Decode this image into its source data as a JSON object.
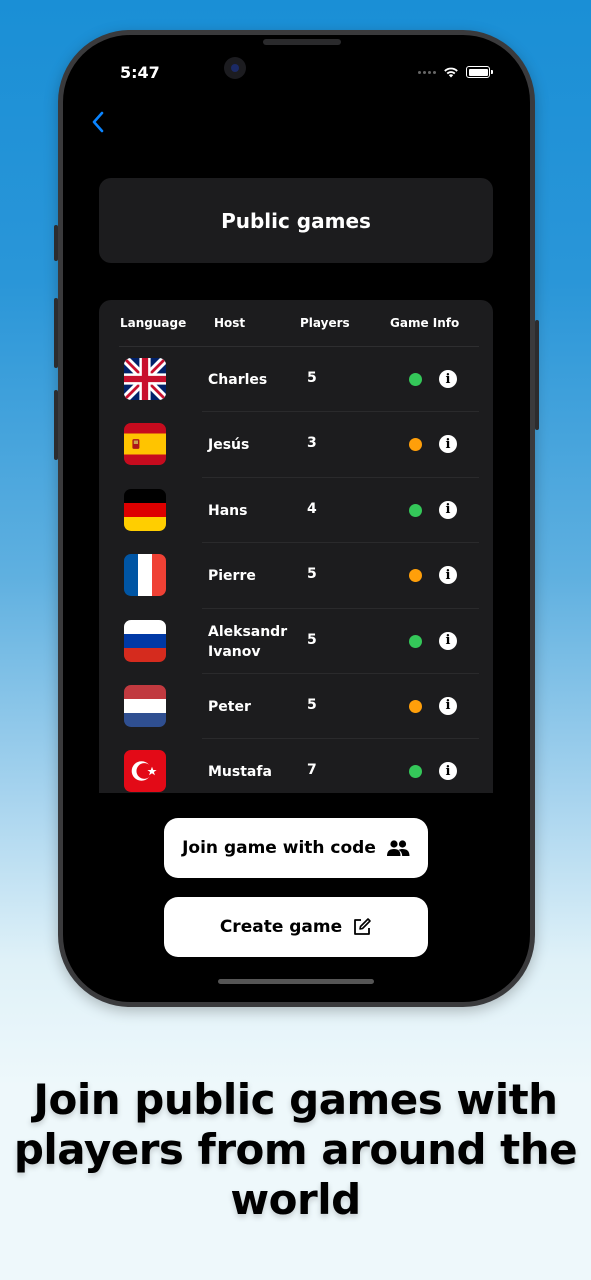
{
  "status_bar": {
    "time": "5:47"
  },
  "nav": {
    "back_icon": "chevron-left-icon"
  },
  "title": "Public games",
  "table": {
    "headers": [
      "Language",
      "Host",
      "Players",
      "Game Info"
    ],
    "rows": [
      {
        "flag": "united-kingdom",
        "host": "Charles",
        "players": "5",
        "status": "green"
      },
      {
        "flag": "spain",
        "host": "Jesús",
        "players": "3",
        "status": "orange"
      },
      {
        "flag": "germany",
        "host": "Hans",
        "players": "4",
        "status": "green"
      },
      {
        "flag": "france",
        "host": "Pierre",
        "players": "5",
        "status": "orange"
      },
      {
        "flag": "russia",
        "host": "Aleksandr Ivanov",
        "players": "5",
        "status": "green"
      },
      {
        "flag": "netherlands",
        "host": "Peter",
        "players": "5",
        "status": "orange"
      },
      {
        "flag": "turkey",
        "host": "Mustafa",
        "players": "7",
        "status": "green"
      }
    ],
    "info_glyph": "i"
  },
  "buttons": {
    "join_code": {
      "label": "Join game with code",
      "icon": "people-icon"
    },
    "create": {
      "label": "Create game",
      "icon": "edit-square-icon"
    }
  },
  "colors": {
    "status_green": "#34c759",
    "status_orange": "#ff9f0a",
    "accent_blue": "#0a84ff"
  },
  "caption": "Join public games with players from around the world"
}
